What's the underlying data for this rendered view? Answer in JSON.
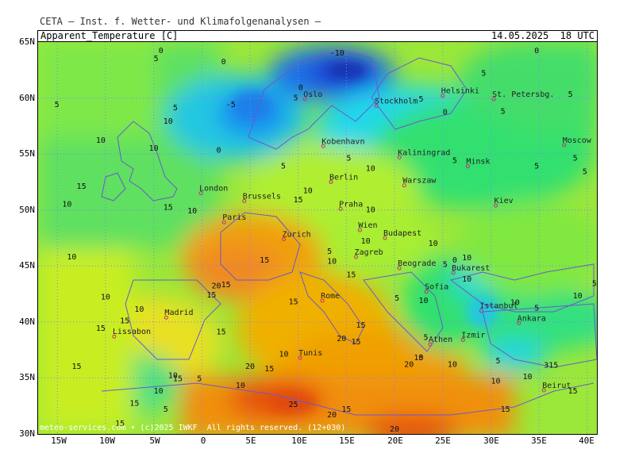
{
  "header": {
    "source": "CETA — Inst. f. Wetter- und Klimafolgenanalysen —",
    "parameter": "Apparent_Temperature [C]",
    "valid": "14.05.2025  18 UTC"
  },
  "footer": {
    "credit": "meteo-services.com • (c)2025 IWKF  All rights reserved. (12+030)"
  },
  "lat_labels": [
    "65N",
    "60N",
    "55N",
    "50N",
    "45N",
    "40N",
    "35N",
    "30N"
  ],
  "lon_labels": [
    "15W",
    "10W",
    "5W",
    "0",
    "5E",
    "10E",
    "15E",
    "20E",
    "25E",
    "30E",
    "35E",
    "40E"
  ],
  "cities": [
    {
      "name": "Oslo",
      "lon": 10.7,
      "lat": 59.9
    },
    {
      "name": "Stockholm",
      "lon": 18.1,
      "lat": 59.3
    },
    {
      "name": "Helsinki",
      "lon": 25.0,
      "lat": 60.2
    },
    {
      "name": "St. Petersbg.",
      "lon": 30.3,
      "lat": 59.9
    },
    {
      "name": "Moscow",
      "lon": 37.6,
      "lat": 55.8
    },
    {
      "name": "Kobenhavn",
      "lon": 12.6,
      "lat": 55.7
    },
    {
      "name": "Kaliningrad",
      "lon": 20.5,
      "lat": 54.7
    },
    {
      "name": "Minsk",
      "lon": 27.6,
      "lat": 53.9
    },
    {
      "name": "London",
      "lon": -0.1,
      "lat": 51.5
    },
    {
      "name": "Berlin",
      "lon": 13.4,
      "lat": 52.5
    },
    {
      "name": "Warszaw",
      "lon": 21.0,
      "lat": 52.2
    },
    {
      "name": "Brussels",
      "lon": 4.4,
      "lat": 50.8
    },
    {
      "name": "Praha",
      "lon": 14.4,
      "lat": 50.1
    },
    {
      "name": "Kiev",
      "lon": 30.5,
      "lat": 50.4
    },
    {
      "name": "Paris",
      "lon": 2.3,
      "lat": 48.9
    },
    {
      "name": "Wien",
      "lon": 16.4,
      "lat": 48.2
    },
    {
      "name": "Budapest",
      "lon": 19.0,
      "lat": 47.5
    },
    {
      "name": "Zurich",
      "lon": 8.5,
      "lat": 47.4
    },
    {
      "name": "Zagreb",
      "lon": 16.0,
      "lat": 45.8
    },
    {
      "name": "Beograde",
      "lon": 20.5,
      "lat": 44.8
    },
    {
      "name": "Bukarest",
      "lon": 26.1,
      "lat": 44.4
    },
    {
      "name": "Sofia",
      "lon": 23.3,
      "lat": 42.7
    },
    {
      "name": "Rome",
      "lon": 12.5,
      "lat": 41.9
    },
    {
      "name": "Madrid",
      "lon": -3.7,
      "lat": 40.4
    },
    {
      "name": "Lissabon",
      "lon": -9.1,
      "lat": 38.7
    },
    {
      "name": "Istanbul",
      "lon": 29.0,
      "lat": 41.0
    },
    {
      "name": "Ankara",
      "lon": 32.9,
      "lat": 39.9
    },
    {
      "name": "Athen",
      "lon": 23.7,
      "lat": 38.0
    },
    {
      "name": "Izmir",
      "lon": 27.1,
      "lat": 38.4
    },
    {
      "name": "Tunis",
      "lon": 10.2,
      "lat": 36.8
    },
    {
      "name": "Beirut",
      "lon": 35.5,
      "lat": 33.9
    }
  ],
  "contour_labels": [
    {
      "v": "-10",
      "lon": 13.3,
      "lat": 63.8
    },
    {
      "v": "0",
      "lon": -4.5,
      "lat": 64.0
    },
    {
      "v": "5",
      "lon": -5.0,
      "lat": 63.3
    },
    {
      "v": "0",
      "lon": 2.0,
      "lat": 63.0
    },
    {
      "v": "-5",
      "lon": 2.5,
      "lat": 59.2
    },
    {
      "v": "0",
      "lon": 10.0,
      "lat": 60.7
    },
    {
      "v": "5",
      "lon": 9.5,
      "lat": 59.8
    },
    {
      "v": "5",
      "lon": -15.3,
      "lat": 59.2
    },
    {
      "v": "5",
      "lon": -3.0,
      "lat": 58.9
    },
    {
      "v": "10",
      "lon": -4.0,
      "lat": 57.7
    },
    {
      "v": "10",
      "lon": -11.0,
      "lat": 56.0
    },
    {
      "v": "10",
      "lon": -5.5,
      "lat": 55.3
    },
    {
      "v": "0",
      "lon": 1.5,
      "lat": 55.1
    },
    {
      "v": "5",
      "lon": 22.5,
      "lat": 59.7
    },
    {
      "v": "5",
      "lon": 29.0,
      "lat": 62.0
    },
    {
      "v": "0",
      "lon": 34.5,
      "lat": 64.0
    },
    {
      "v": "5",
      "lon": 38.0,
      "lat": 60.1
    },
    {
      "v": "0",
      "lon": 25.0,
      "lat": 58.5
    },
    {
      "v": "5",
      "lon": 31.0,
      "lat": 58.6
    },
    {
      "v": "5",
      "lon": 8.2,
      "lat": 53.7
    },
    {
      "v": "5",
      "lon": 15.0,
      "lat": 54.4
    },
    {
      "v": "10",
      "lon": 17.0,
      "lat": 53.5
    },
    {
      "v": "5",
      "lon": 26.0,
      "lat": 54.2
    },
    {
      "v": "5",
      "lon": 34.5,
      "lat": 53.7
    },
    {
      "v": "5",
      "lon": 38.5,
      "lat": 54.4
    },
    {
      "v": "5",
      "lon": 39.5,
      "lat": 53.2
    },
    {
      "v": "15",
      "lon": -13.0,
      "lat": 51.9
    },
    {
      "v": "10",
      "lon": -14.5,
      "lat": 50.3
    },
    {
      "v": "15",
      "lon": -4.0,
      "lat": 50.0
    },
    {
      "v": "10",
      "lon": -1.5,
      "lat": 49.7
    },
    {
      "v": "10",
      "lon": 10.5,
      "lat": 51.5
    },
    {
      "v": "15",
      "lon": 9.5,
      "lat": 50.7
    },
    {
      "v": "10",
      "lon": 17.0,
      "lat": 49.8
    },
    {
      "v": "10",
      "lon": -14.0,
      "lat": 45.6
    },
    {
      "v": "15",
      "lon": 6.0,
      "lat": 45.3
    },
    {
      "v": "5",
      "lon": 13.0,
      "lat": 46.1
    },
    {
      "v": "10",
      "lon": 13.0,
      "lat": 45.2
    },
    {
      "v": "10",
      "lon": 16.5,
      "lat": 47.0
    },
    {
      "v": "10",
      "lon": 23.5,
      "lat": 46.8
    },
    {
      "v": "10",
      "lon": 27.0,
      "lat": 45.5
    },
    {
      "v": "5",
      "lon": 25.0,
      "lat": 44.9
    },
    {
      "v": "0",
      "lon": 26.0,
      "lat": 45.3
    },
    {
      "v": "10",
      "lon": 27.0,
      "lat": 43.6
    },
    {
      "v": "15",
      "lon": 2.0,
      "lat": 43.1
    },
    {
      "v": "15",
      "lon": 0.5,
      "lat": 42.2
    },
    {
      "v": "20",
      "lon": 1.0,
      "lat": 43.0
    },
    {
      "v": "15",
      "lon": 15.0,
      "lat": 44.0
    },
    {
      "v": "10",
      "lon": -10.5,
      "lat": 42.0
    },
    {
      "v": "10",
      "lon": -7.0,
      "lat": 40.9
    },
    {
      "v": "15",
      "lon": -8.5,
      "lat": 39.9
    },
    {
      "v": "15",
      "lon": -11.0,
      "lat": 39.2
    },
    {
      "v": "15",
      "lon": 9.0,
      "lat": 41.6
    },
    {
      "v": "20",
      "lon": 14.0,
      "lat": 38.3
    },
    {
      "v": "15",
      "lon": 15.5,
      "lat": 38.0
    },
    {
      "v": "15",
      "lon": 16.0,
      "lat": 39.5
    },
    {
      "v": "15",
      "lon": 1.5,
      "lat": 38.9
    },
    {
      "v": "10",
      "lon": 22.0,
      "lat": 36.6
    },
    {
      "v": "5",
      "lon": 22.5,
      "lat": 36.6
    },
    {
      "v": "10",
      "lon": 25.5,
      "lat": 36.0
    },
    {
      "v": "5",
      "lon": 30.5,
      "lat": 36.3
    },
    {
      "v": "10",
      "lon": 30.0,
      "lat": 34.5
    },
    {
      "v": "10",
      "lon": 33.3,
      "lat": 34.9
    },
    {
      "v": "10",
      "lon": 32.0,
      "lat": 41.5
    },
    {
      "v": "5",
      "lon": 34.5,
      "lat": 41.0
    },
    {
      "v": "10",
      "lon": 38.5,
      "lat": 42.1
    },
    {
      "v": "5",
      "lon": 40.5,
      "lat": 43.2
    },
    {
      "v": "315",
      "lon": 35.5,
      "lat": 35.9
    },
    {
      "v": "5",
      "lon": 23.0,
      "lat": 38.4
    },
    {
      "v": "10",
      "lon": 22.5,
      "lat": 41.7
    },
    {
      "v": "5",
      "lon": 20.0,
      "lat": 41.9
    },
    {
      "v": "15",
      "lon": -13.5,
      "lat": 35.8
    },
    {
      "v": "15",
      "lon": -3.0,
      "lat": 34.7
    },
    {
      "v": "10",
      "lon": -3.5,
      "lat": 35.0
    },
    {
      "v": "5",
      "lon": -0.5,
      "lat": 34.7
    },
    {
      "v": "10",
      "lon": -5.0,
      "lat": 33.6
    },
    {
      "v": "15",
      "lon": -7.5,
      "lat": 32.5
    },
    {
      "v": "5",
      "lon": -4.0,
      "lat": 32.0
    },
    {
      "v": "15",
      "lon": -9.0,
      "lat": 30.7
    },
    {
      "v": "20",
      "lon": 4.5,
      "lat": 35.8
    },
    {
      "v": "15",
      "lon": 6.5,
      "lat": 35.6
    },
    {
      "v": "10",
      "lon": 8.0,
      "lat": 36.9
    },
    {
      "v": "10",
      "lon": 3.5,
      "lat": 34.1
    },
    {
      "v": "25",
      "lon": 9.0,
      "lat": 32.4
    },
    {
      "v": "20",
      "lon": 13.0,
      "lat": 31.5
    },
    {
      "v": "15",
      "lon": 14.5,
      "lat": 32.0
    },
    {
      "v": "20",
      "lon": 21.0,
      "lat": 36.0
    },
    {
      "v": "20",
      "lon": 19.5,
      "lat": 30.2
    },
    {
      "v": "15",
      "lon": 38.0,
      "lat": 33.6
    },
    {
      "v": "15",
      "lon": 31.0,
      "lat": 32.0
    }
  ],
  "colors": {
    "deep_cold": "#1a3acc",
    "cold": "#1e90ff",
    "cool": "#00d5e5",
    "mild": "#30e070",
    "green": "#7df030",
    "yellow": "#f0f000",
    "warm": "#f0b400",
    "hot": "#f07820",
    "very_hot": "#e65010"
  }
}
